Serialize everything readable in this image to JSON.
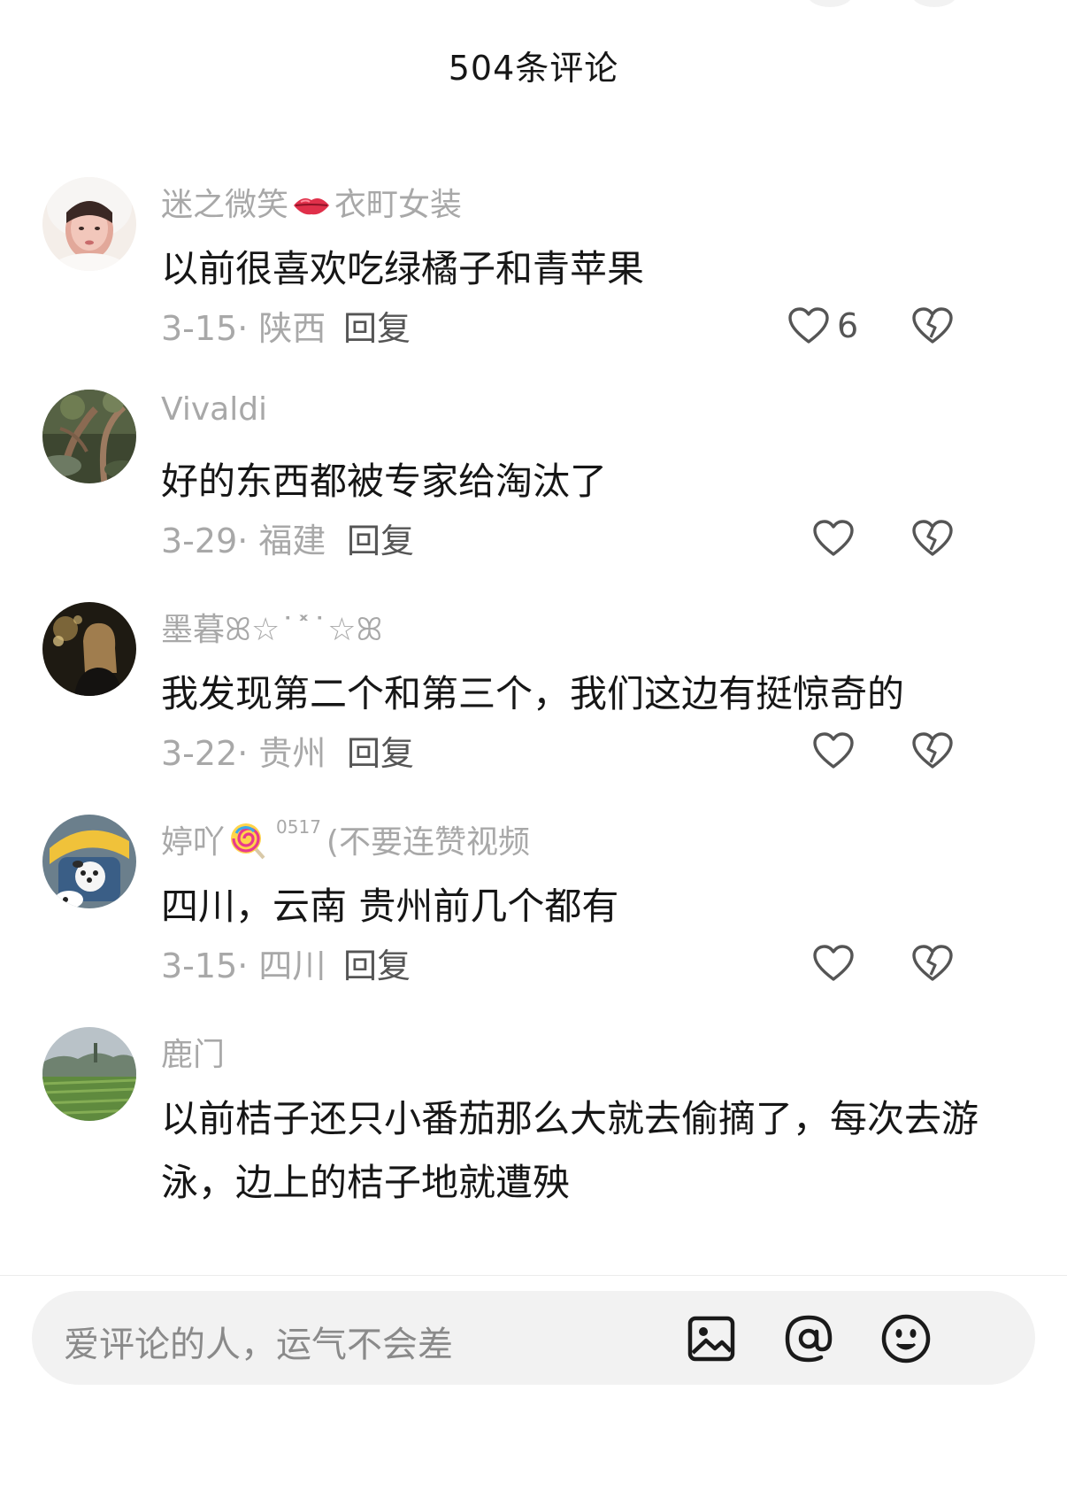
{
  "header": {
    "title": "504条评论"
  },
  "comments": [
    {
      "username_a": "迷之微笑",
      "username_emoji": "lips-emoji",
      "username_b": "衣町女装",
      "text": "以前很喜欢吃绿橘子和青苹果",
      "date": "3-15",
      "location": "陕西",
      "reply_label": "回复",
      "like_count": "6"
    },
    {
      "username_a": "Vivaldi",
      "text": "好的东西都被专家给淘汰了",
      "date": "3-29",
      "location": "福建",
      "reply_label": "回复",
      "like_count": ""
    },
    {
      "username_a": "墨暮ꕤ☆˙˟˙☆ꕤ",
      "text": "我发现第二个和第三个，我们这边有挺惊奇的",
      "date": "3-22",
      "location": "贵州",
      "reply_label": "回复",
      "like_count": ""
    },
    {
      "username_a": "婷吖",
      "username_emoji": "lollipop-emoji",
      "username_tiny": "0517",
      "username_b": "(不要连赞视频",
      "text": "四川，云南 贵州前几个都有",
      "date": "3-15",
      "location": "四川",
      "reply_label": "回复",
      "like_count": ""
    },
    {
      "username_a": "鹿门",
      "text": "以前桔子还只小番茄那么大就去偷摘了，每次去游泳，边上的桔子地就遭殃"
    }
  ],
  "input": {
    "placeholder": "爱评论的人，运气不会差",
    "icons": [
      "image-icon",
      "at-icon",
      "emoji-icon"
    ]
  },
  "colors": {
    "muted_text": "#a8a8a8",
    "body_text": "#161616",
    "reply_text": "#555555",
    "input_bg": "#f2f2f2"
  }
}
